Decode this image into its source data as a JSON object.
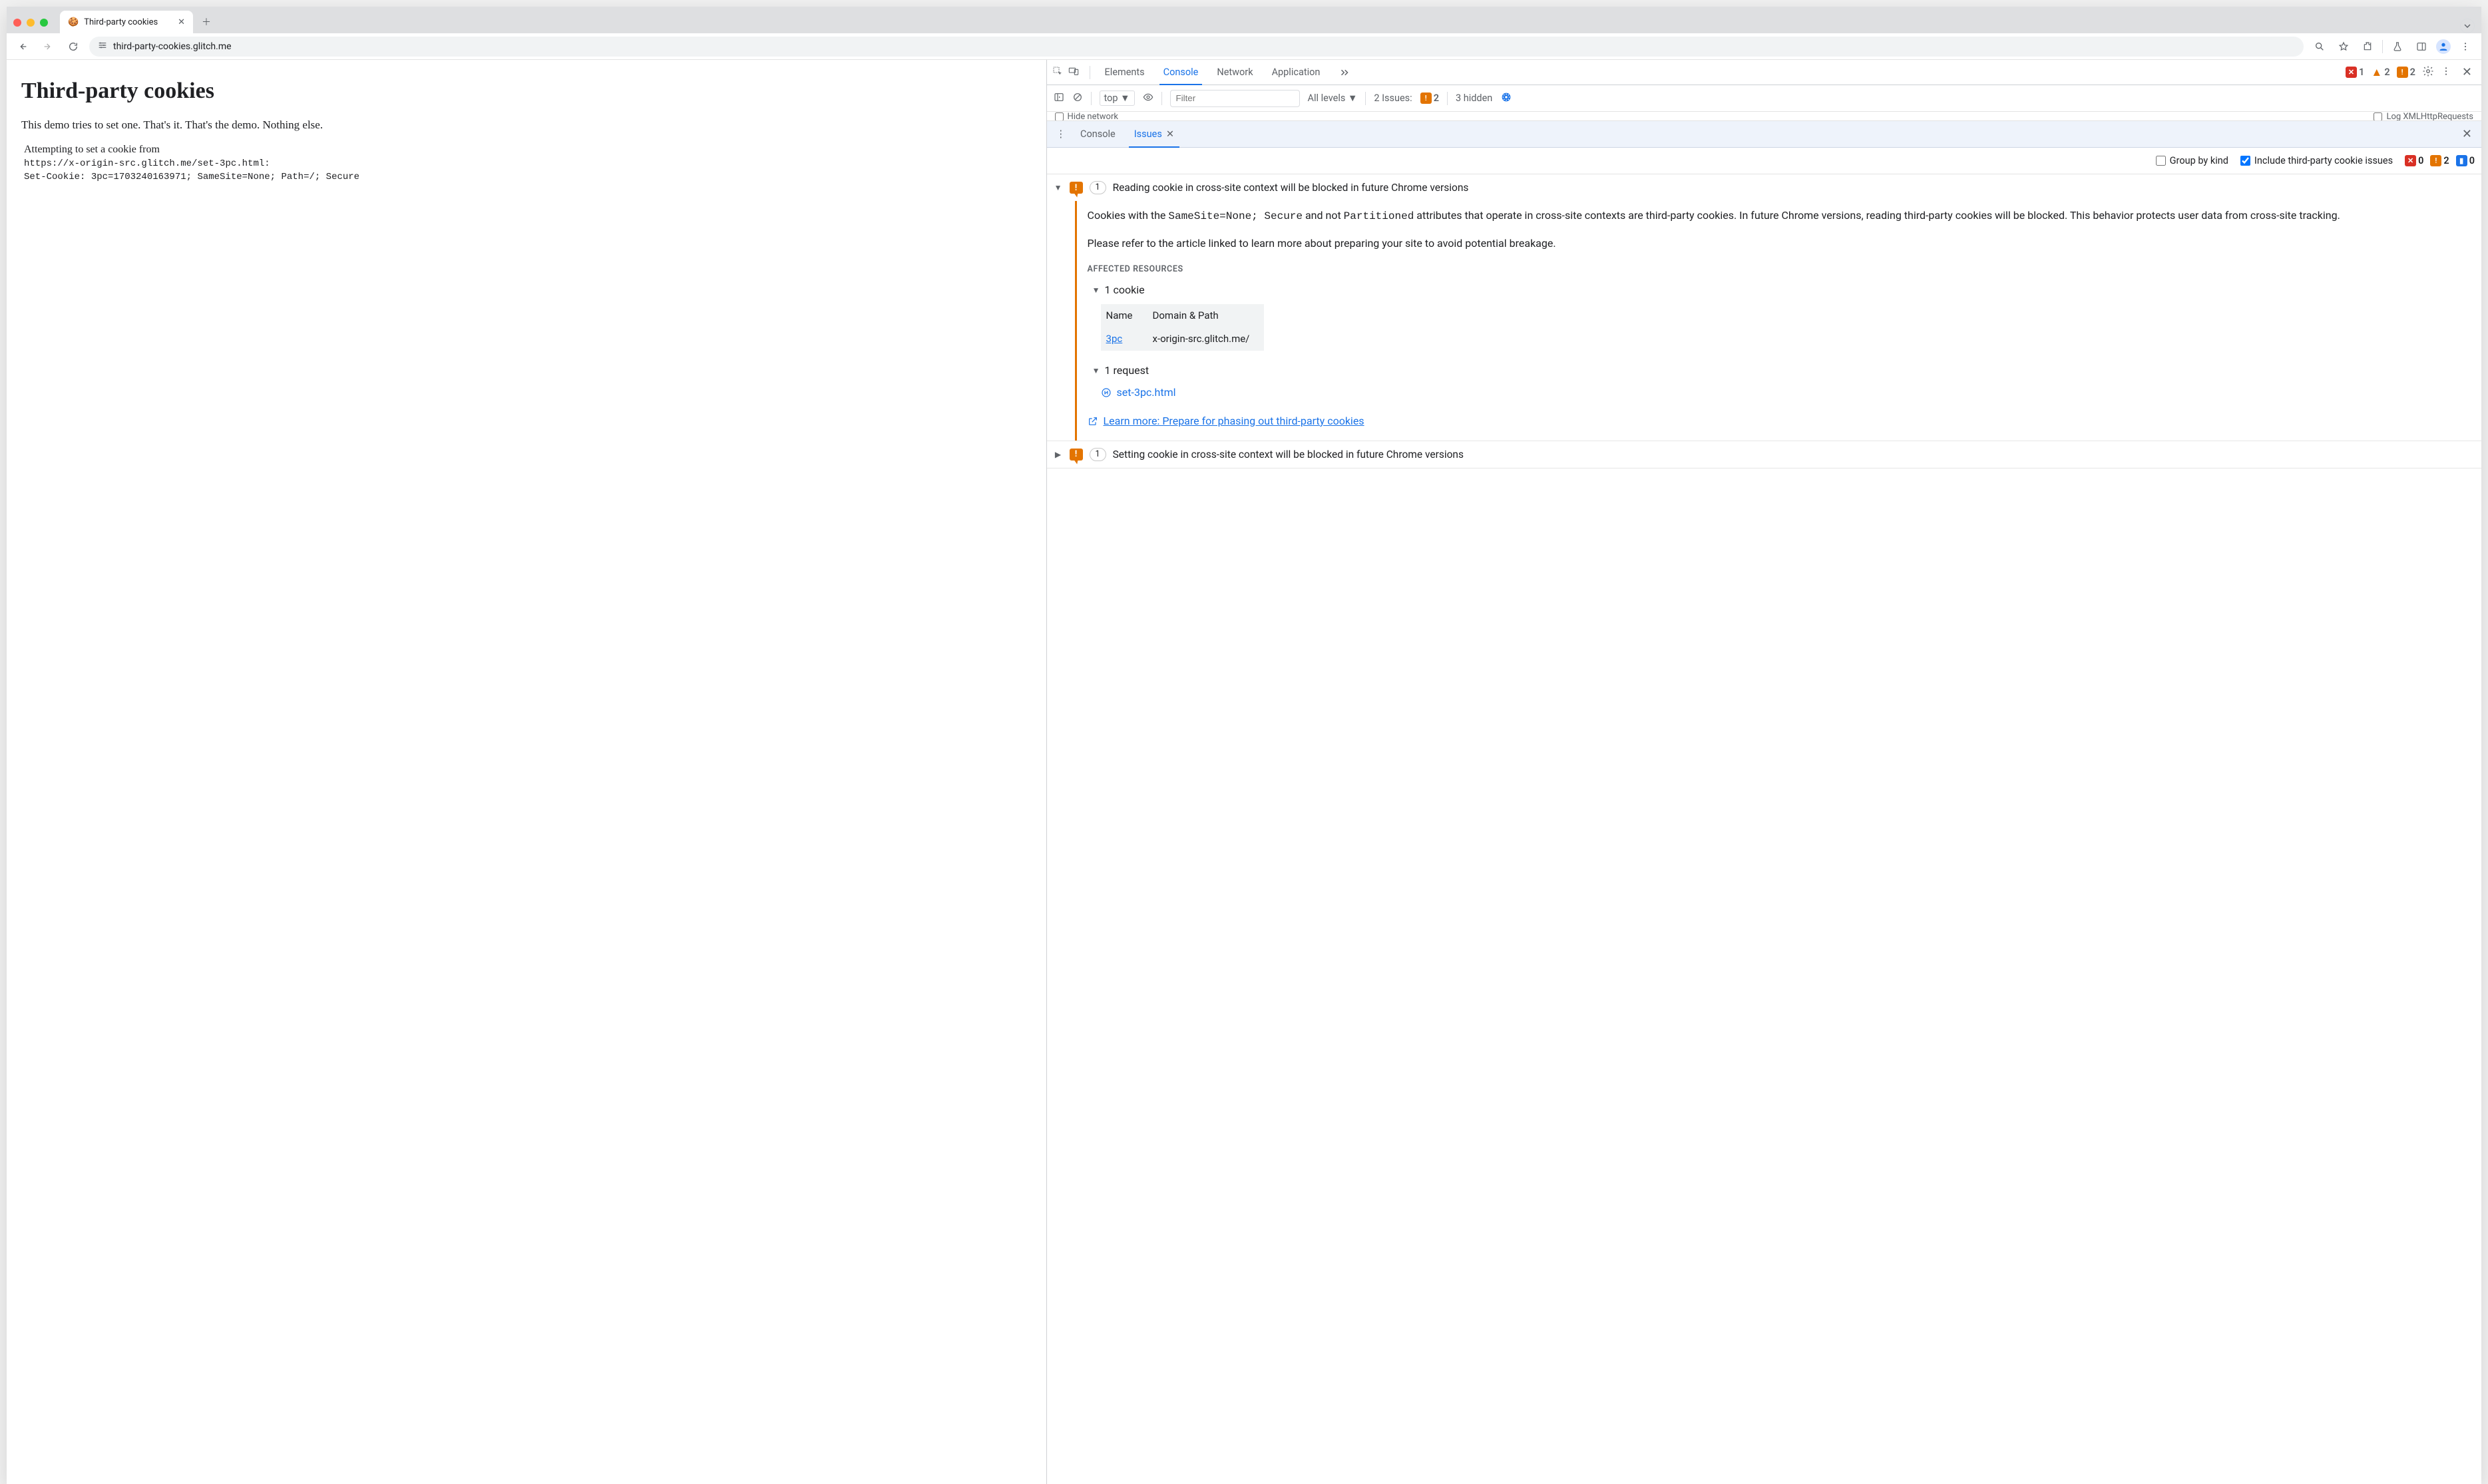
{
  "browser": {
    "tab_title": "Third-party cookies",
    "url": "third-party-cookies.glitch.me"
  },
  "page": {
    "h1": "Third-party cookies",
    "intro": "This demo tries to set one. That's it. That's the demo. Nothing else.",
    "attempt_line": "Attempting to set a cookie from",
    "source_url": "https://x-origin-src.glitch.me/set-3pc.html:",
    "set_cookie": "Set-Cookie: 3pc=1703240163971; SameSite=None; Path=/; Secure"
  },
  "devtools": {
    "tabs": {
      "elements": "Elements",
      "console": "Console",
      "network": "Network",
      "application": "Application"
    },
    "status": {
      "errors": "1",
      "warnings_tri": "2",
      "warnings_box": "2"
    },
    "settings_hidden": "3 hidden",
    "console_bar": {
      "context": "top",
      "filter_placeholder": "Filter",
      "levels": "All levels",
      "issues_label": "2 Issues:",
      "issues_count": "2"
    },
    "row3": {
      "left": "Hide network",
      "right": "Log XMLHttpRequests"
    },
    "drawer": {
      "console": "Console",
      "issues": "Issues"
    },
    "issues_toolbar": {
      "group": "Group by kind",
      "include": "Include third-party cookie issues",
      "err": "0",
      "warn": "2",
      "info": "0"
    },
    "issues": [
      {
        "count": "1",
        "title": "Reading cookie in cross-site context will be blocked in future Chrome versions",
        "expanded": true,
        "body_p1_a": "Cookies with the ",
        "body_p1_code": "SameSite=None; Secure",
        "body_p1_b": " and not ",
        "body_p1_code2": "Partitioned",
        "body_p1_c": " attributes that operate in cross-site contexts are third-party cookies. In future Chrome versions, reading third-party cookies will be blocked. This behavior protects user data from cross-site tracking.",
        "body_p2": "Please refer to the article linked to learn more about preparing your site to avoid potential breakage.",
        "affected_heading": "AFFECTED RESOURCES",
        "cookie_row": "1 cookie",
        "table": {
          "h1": "Name",
          "h2": "Domain & Path",
          "name": "3pc",
          "domain": "x-origin-src.glitch.me/"
        },
        "request_row": "1 request",
        "request_link": "set-3pc.html",
        "learn_more": "Learn more: Prepare for phasing out third-party cookies"
      },
      {
        "count": "1",
        "title": "Setting cookie in cross-site context will be blocked in future Chrome versions",
        "expanded": false
      }
    ]
  }
}
